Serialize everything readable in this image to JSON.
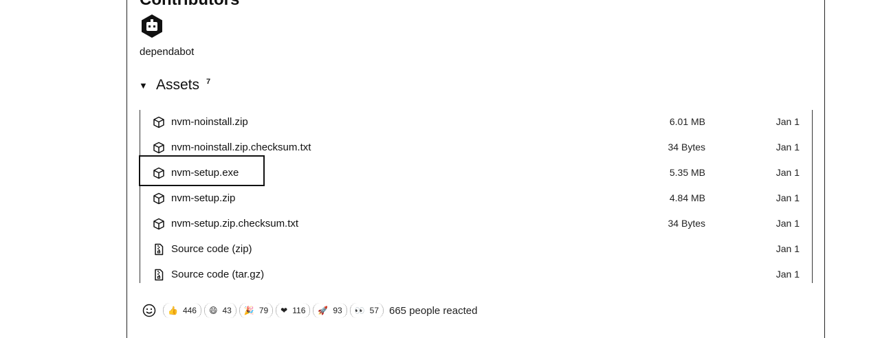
{
  "contributors": {
    "title": "Contributors",
    "name": "dependabot"
  },
  "assets": {
    "title": "Assets",
    "count": "7",
    "items": [
      {
        "name": "nvm-noinstall.zip",
        "size": "6.01 MB",
        "date": "Jan 1",
        "icon": "package-icon"
      },
      {
        "name": "nvm-noinstall.zip.checksum.txt",
        "size": "34 Bytes",
        "date": "Jan 1",
        "icon": "package-icon"
      },
      {
        "name": "nvm-setup.exe",
        "size": "5.35 MB",
        "date": "Jan 1",
        "icon": "package-icon"
      },
      {
        "name": "nvm-setup.zip",
        "size": "4.84 MB",
        "date": "Jan 1",
        "icon": "package-icon"
      },
      {
        "name": "nvm-setup.zip.checksum.txt",
        "size": "34 Bytes",
        "date": "Jan 1",
        "icon": "package-icon"
      },
      {
        "name": "Source code (zip)",
        "size": "",
        "date": "Jan 1",
        "icon": "file-zip-icon"
      },
      {
        "name": "Source code (tar.gz)",
        "size": "",
        "date": "Jan 1",
        "icon": "file-zip-icon"
      }
    ]
  },
  "reactions": {
    "items": [
      {
        "emoji": "👍",
        "count": "446",
        "icon": "thumbs-up-icon"
      },
      {
        "emoji": "😄",
        "count": "43",
        "icon": "laugh-icon"
      },
      {
        "emoji": "🎉",
        "count": "79",
        "icon": "hooray-icon"
      },
      {
        "emoji": "❤",
        "count": "116",
        "icon": "heart-icon"
      },
      {
        "emoji": "🚀",
        "count": "93",
        "icon": "rocket-icon"
      },
      {
        "emoji": "👀",
        "count": "57",
        "icon": "eyes-icon"
      }
    ],
    "summary": "665 people reacted"
  }
}
